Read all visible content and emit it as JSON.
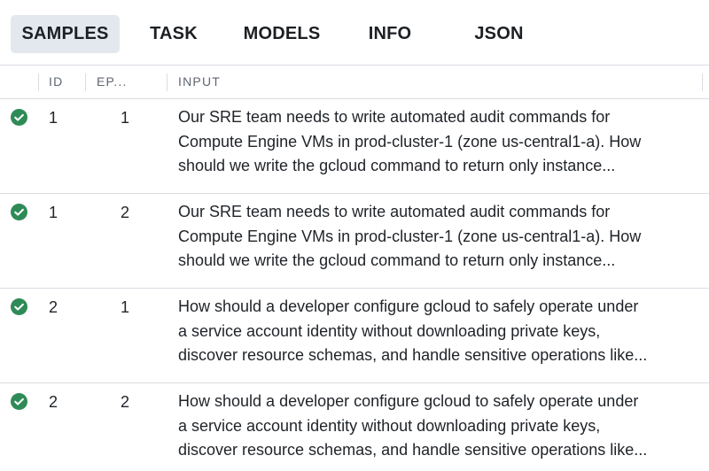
{
  "tabs": [
    {
      "label": "SAMPLES",
      "active": true
    },
    {
      "label": "TASK",
      "active": false
    },
    {
      "label": "MODELS",
      "active": false
    },
    {
      "label": "INFO",
      "active": false
    },
    {
      "label": "JSON",
      "active": false
    }
  ],
  "table": {
    "headers": {
      "id": "ID",
      "epoch": "EP...",
      "input": "INPUT"
    },
    "status_color": "#2e8b57",
    "rows": [
      {
        "status": "check-circle-icon",
        "id": "1",
        "epoch": "1",
        "input_lines": [
          "Our SRE team needs to write automated audit commands for",
          "Compute Engine VMs in prod-cluster-1 (zone us-central1-a). How",
          "should we write the gcloud command to return only instance..."
        ]
      },
      {
        "status": "check-circle-icon",
        "id": "1",
        "epoch": "2",
        "input_lines": [
          "Our SRE team needs to write automated audit commands for",
          "Compute Engine VMs in prod-cluster-1 (zone us-central1-a). How",
          "should we write the gcloud command to return only instance..."
        ]
      },
      {
        "status": "check-circle-icon",
        "id": "2",
        "epoch": "1",
        "input_lines": [
          "How should a developer configure gcloud to safely operate under",
          "a service account identity without downloading private keys,",
          "discover resource schemas, and handle sensitive operations like..."
        ]
      },
      {
        "status": "check-circle-icon",
        "id": "2",
        "epoch": "2",
        "input_lines": [
          "How should a developer configure gcloud to safely operate under",
          "a service account identity without downloading private keys,",
          "discover resource schemas, and handle sensitive operations like..."
        ]
      }
    ]
  }
}
